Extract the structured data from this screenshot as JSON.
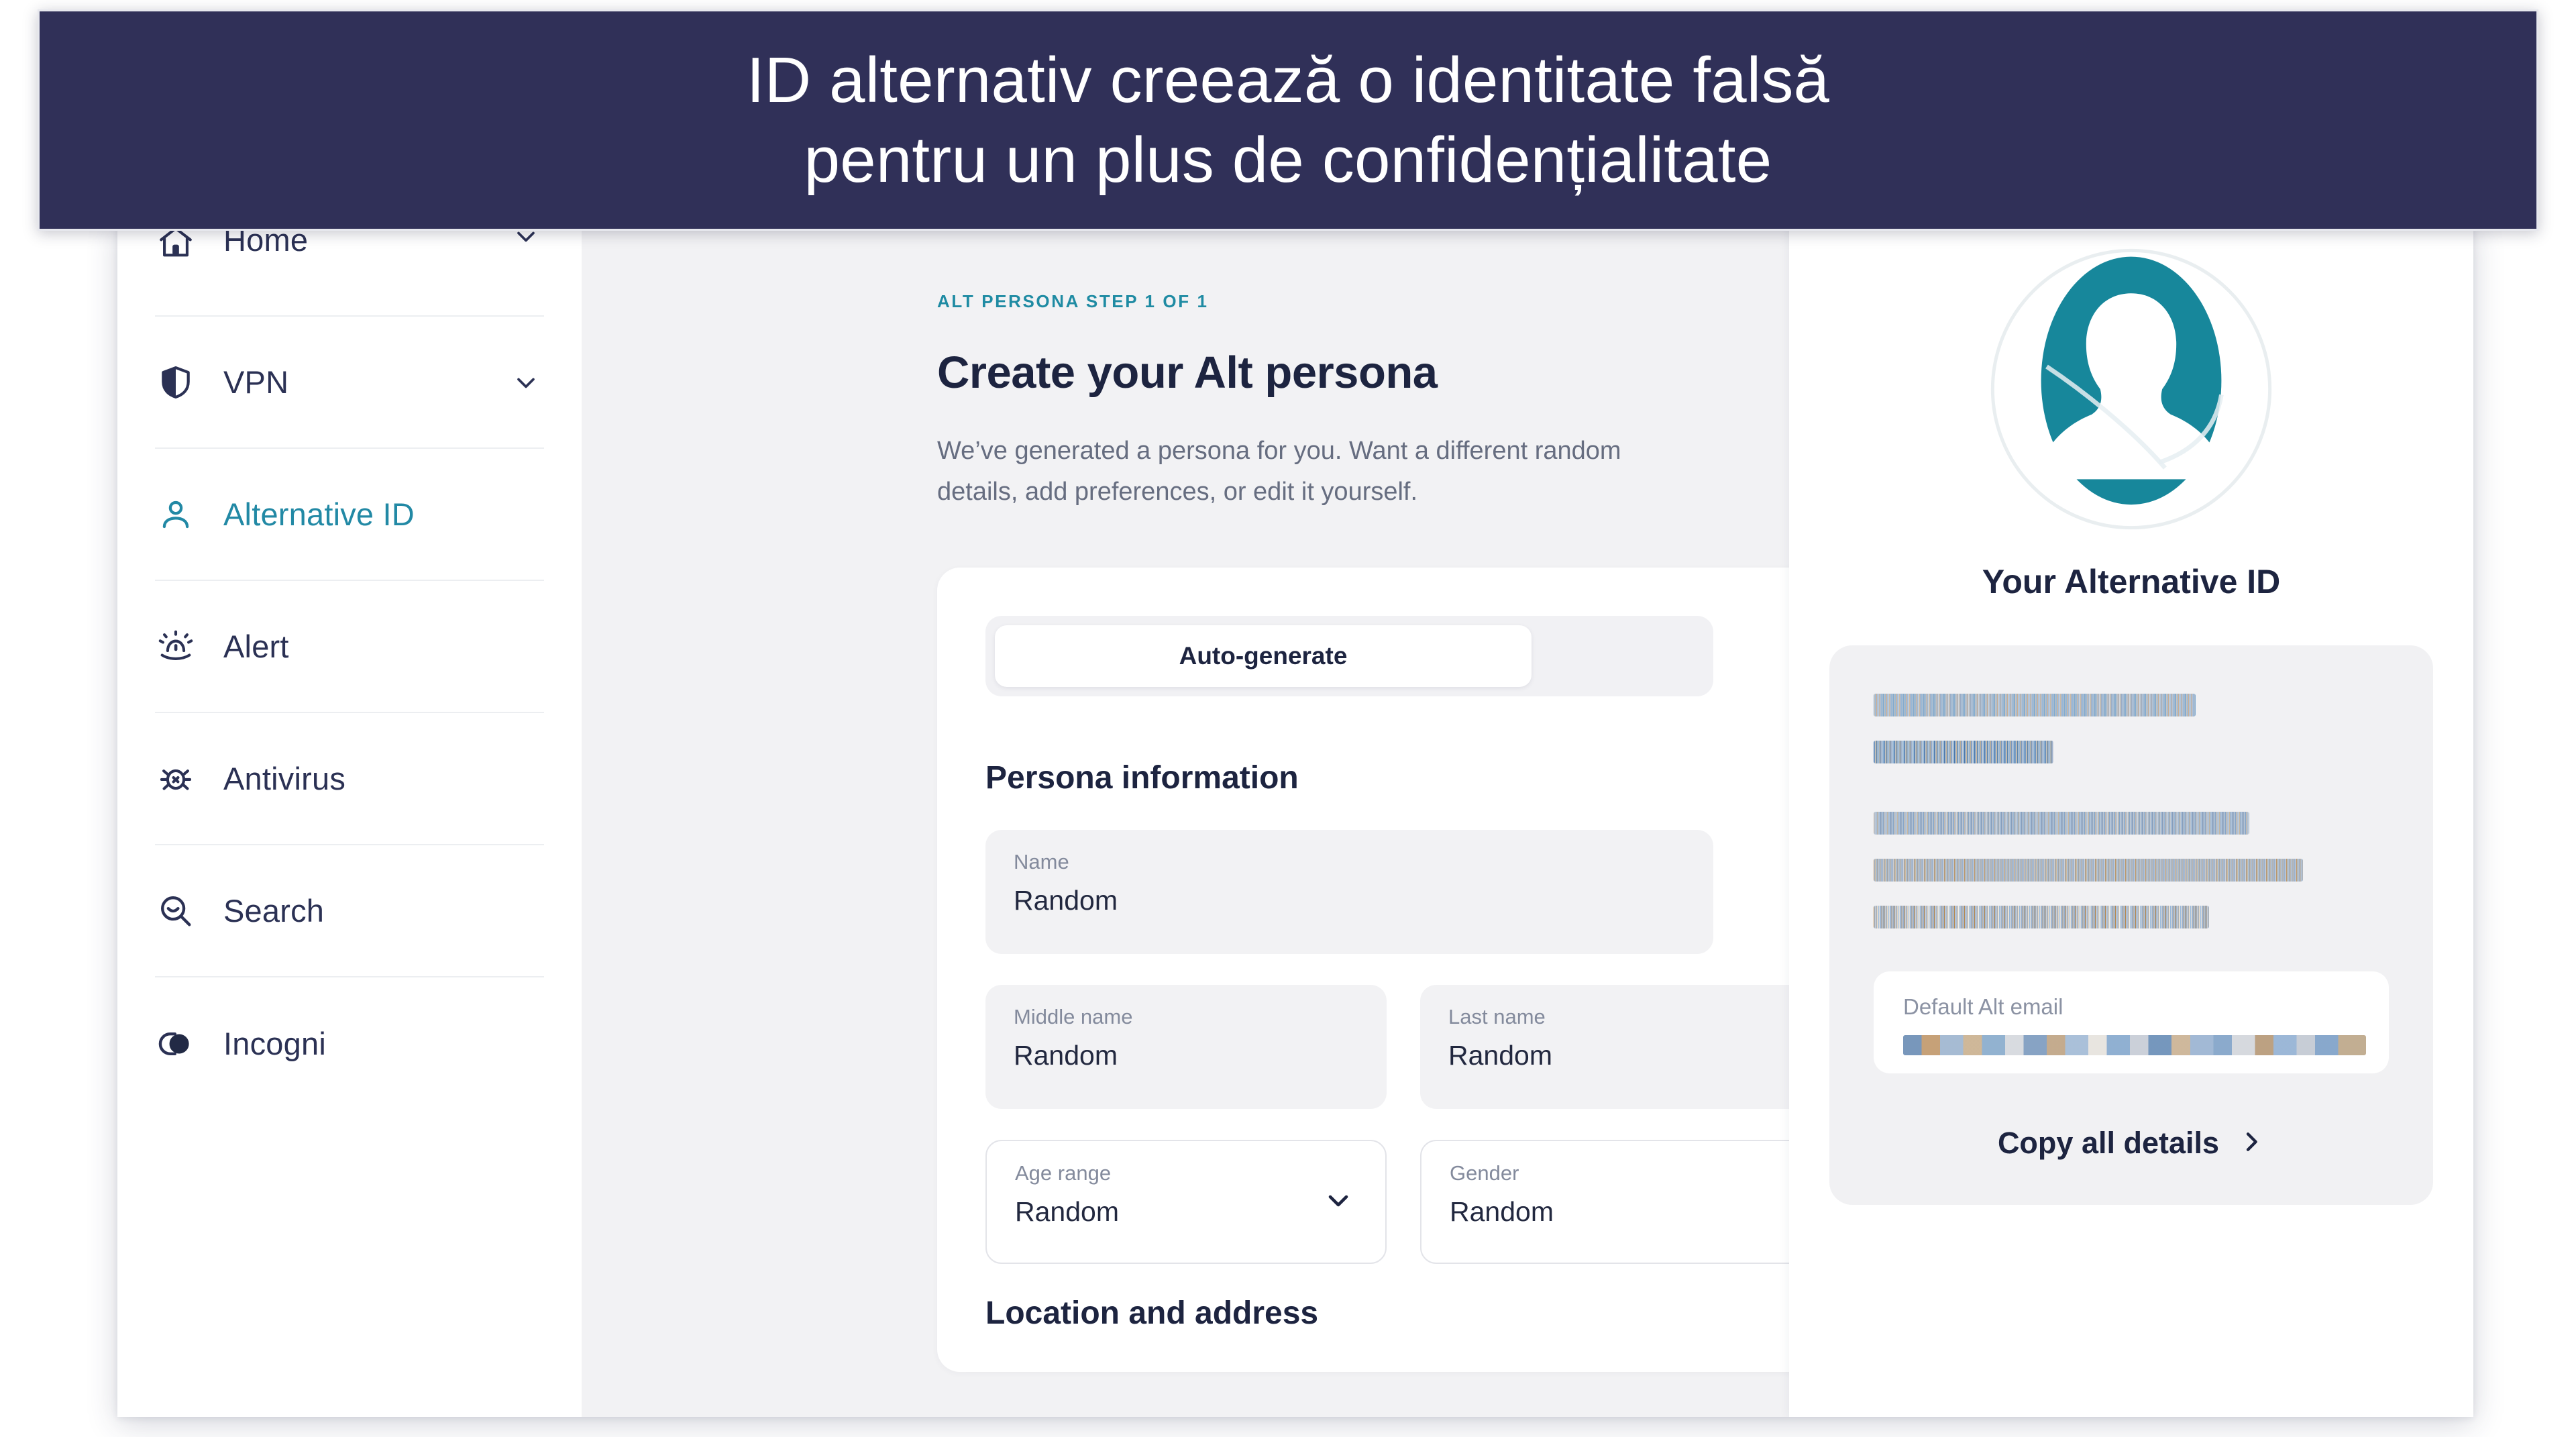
{
  "caption": {
    "line1": "ID alternativ creează o identitate falsă",
    "line2": "pentru un plus de confidențialitate",
    "background": "#303058",
    "text_color": "#ffffff"
  },
  "colors": {
    "accent_teal": "#1f8ba3",
    "navy": "#1d2440",
    "avatar_teal": "#17879b",
    "panel_gray": "#f2f2f4"
  },
  "sidebar": {
    "items": [
      {
        "label": "Home",
        "icon": "home-icon",
        "chevron": true,
        "active": false
      },
      {
        "label": "VPN",
        "icon": "shield-icon",
        "chevron": true,
        "active": false
      },
      {
        "label": "Alternative ID",
        "icon": "person-icon",
        "chevron": false,
        "active": true
      },
      {
        "label": "Alert",
        "icon": "alert-icon",
        "chevron": false,
        "active": false
      },
      {
        "label": "Antivirus",
        "icon": "bug-icon",
        "chevron": false,
        "active": false
      },
      {
        "label": "Search",
        "icon": "search-icon",
        "chevron": false,
        "active": false
      },
      {
        "label": "Incogni",
        "icon": "toggle-icon",
        "chevron": false,
        "active": false
      }
    ]
  },
  "main": {
    "eyebrow": "ALT PERSONA STEP 1 OF 1",
    "title": "Create your Alt persona",
    "description": "We’ve generated a persona for you. Want a different random details, add preferences, or edit it yourself.",
    "segmented": {
      "active_label": "Auto-generate"
    },
    "sections": {
      "persona": "Persona information",
      "location": "Location and address"
    },
    "fields": [
      {
        "label": "Name",
        "value": "Random",
        "type": "text"
      },
      {
        "label": "Middle name",
        "value": "Random",
        "type": "text"
      },
      {
        "label": "Last name",
        "value": "Random",
        "type": "text"
      },
      {
        "label": "Age range",
        "value": "Random",
        "type": "select"
      },
      {
        "label": "Gender",
        "value": "Random",
        "type": "select"
      }
    ]
  },
  "right_panel": {
    "avatar_icon": "person-avatar-icon",
    "title": "Your Alternative ID",
    "details_redacted": [
      "redacted-line-1",
      "redacted-line-2",
      "redacted-line-3",
      "redacted-line-4",
      "redacted-line-5"
    ],
    "email": {
      "label": "Default Alt email",
      "value_redacted": "redacted-email"
    },
    "copy_button": {
      "label": "Copy all details",
      "icon": "chevron-right-icon"
    }
  }
}
